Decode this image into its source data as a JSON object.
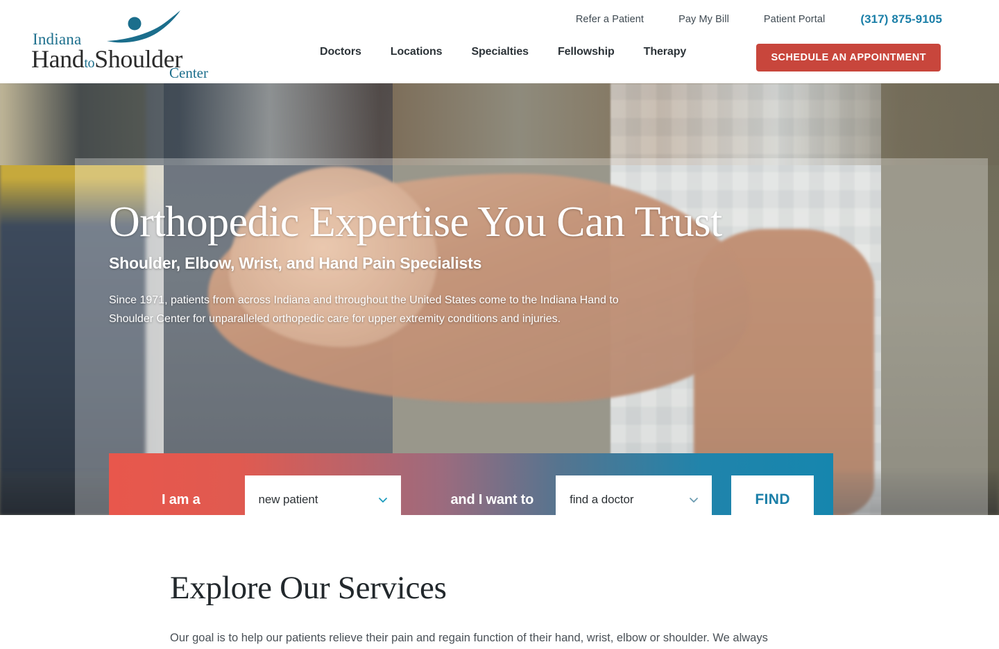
{
  "header": {
    "logo": {
      "line1": "Indiana",
      "line2_a": "Hand",
      "line2_to": "to",
      "line2_b": "Shoulder",
      "line3": "Center",
      "swoosh_icon": "person-swoosh-icon",
      "accent_color": "#1b6e8c",
      "text_color": "#2b2b2b"
    },
    "utility_nav": [
      {
        "label": "Refer a Patient"
      },
      {
        "label": "Pay My Bill"
      },
      {
        "label": "Patient Portal"
      }
    ],
    "phone": "(317) 875-9105",
    "phone_color": "#1b7fa8",
    "main_nav": [
      {
        "label": "Doctors"
      },
      {
        "label": "Locations"
      },
      {
        "label": "Specialties"
      },
      {
        "label": "Fellowship"
      },
      {
        "label": "Therapy"
      }
    ],
    "cta": {
      "label": "SCHEDULE AN APPOINTMENT",
      "bg_color": "#c8463c",
      "text_color": "#ffffff"
    }
  },
  "hero": {
    "title": "Orthopedic Expertise You Can Trust",
    "subtitle": "Shoulder, Elbow, Wrist, and Hand Pain Specialists",
    "paragraph": "Since 1971, patients from across Indiana and throughout the United States come to the Indiana Hand to Shoulder Center for unparalleled orthopedic care for upper extremity conditions and injuries.",
    "finder": {
      "label_1": "I am a",
      "select_1": {
        "value": "new patient",
        "chevron_icon": "chevron-down-icon",
        "options": [
          "new patient"
        ]
      },
      "label_2": "and I want to",
      "select_2": {
        "value": "find a doctor",
        "chevron_icon": "chevron-down-icon",
        "options": [
          "find a doctor"
        ]
      },
      "find_button": "FIND",
      "gradient_start": "#e8574c",
      "gradient_end": "#1686ae",
      "button_text_color": "#1b7fa8"
    }
  },
  "services": {
    "title": "Explore Our Services",
    "paragraph": "Our goal is to help our patients relieve their pain and regain function of their hand, wrist, elbow or shoulder. We always"
  }
}
